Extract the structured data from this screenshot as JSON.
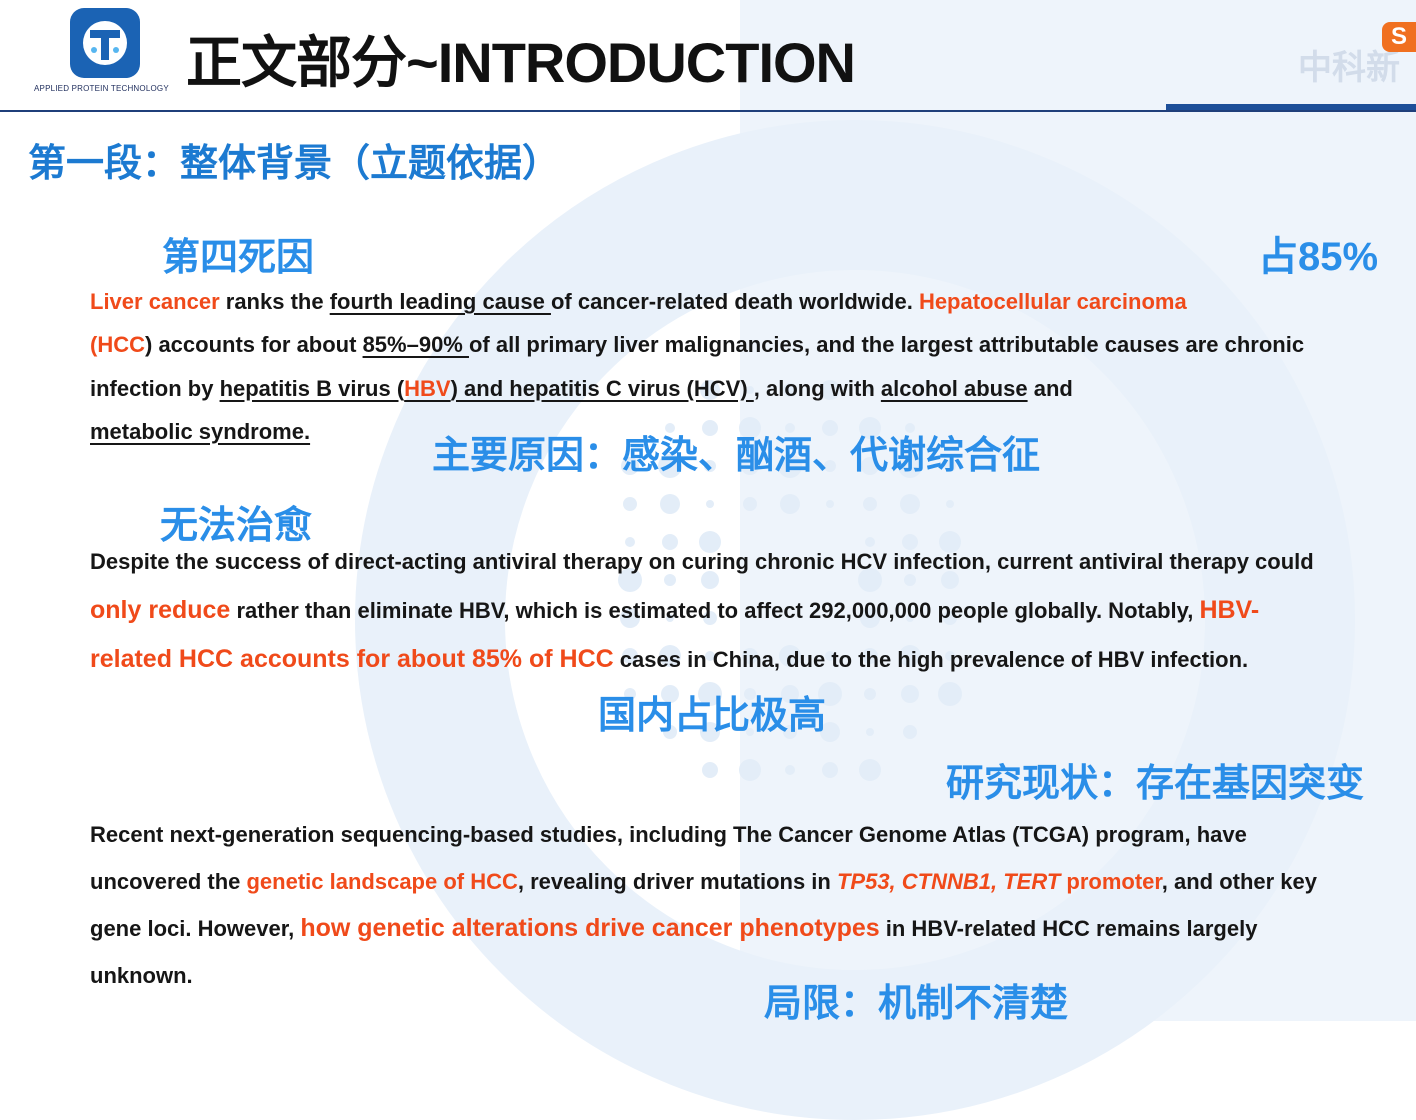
{
  "header": {
    "title": "正文部分~INTRODUCTION",
    "logo_caption": "APPLIED PROTEIN TECHNOLOGY",
    "corner_brand": "中科新",
    "corner_badge": "S"
  },
  "section_heading": "第一段：整体背景（立题依据）",
  "notes": {
    "fourth_cause": "第四死因",
    "pct_85": "占85%",
    "main_causes": "主要原因：感染、酗酒、代谢综合征",
    "incurable": "无法治愈",
    "domestic_high": "国内占比极高",
    "research_status": "研究现状：存在基因突变",
    "limitation": "局限：机制不清楚"
  },
  "p1": {
    "s1": "Liver cancer",
    "s2": " ranks the ",
    "s3": "fourth leading cause ",
    "s4": "of cancer-related death worldwide. ",
    "s5": "Hepatocellular carcinoma",
    "s6": "(HCC",
    "s7": ") accounts for about ",
    "s8": "85%–90% ",
    "s9": "of all primary liver malignancies, and the largest attributable causes are chronic infection by ",
    "s10": "hepatitis B virus (",
    "s11": "HBV",
    "s12": ") and hepatitis C virus (HCV) ",
    "s13": ", along with ",
    "s14": "alcohol abuse",
    "s15": " and ",
    "s16": "metabolic syndrome."
  },
  "p2": {
    "s1": "Despite the success of direct-acting antiviral therapy on curing chronic HCV infection, current antiviral therapy could ",
    "s2": "only reduce",
    "s3": " rather than eliminate HBV, which is estimated to affect 292,000,000 people globally. Notably, ",
    "s4": "HBV-related HCC accounts for about 85% of HCC",
    "s5": " cases in China, due to the high prevalence of HBV infection."
  },
  "p3": {
    "s1": "Recent next-generation sequencing-based studies, including The Cancer Genome Atlas (TCGA) program, have uncovered the ",
    "s2": "genetic landscape of HCC",
    "s3": ", revealing driver mutations in ",
    "s4": "TP53, CTNNB1, TERT",
    "s5": " promoter",
    "s6": ", and other key gene loci. However, ",
    "s7": "how genetic alterations drive cancer phenotypes",
    "s8": " in HBV-related HCC remains largely unknown."
  }
}
